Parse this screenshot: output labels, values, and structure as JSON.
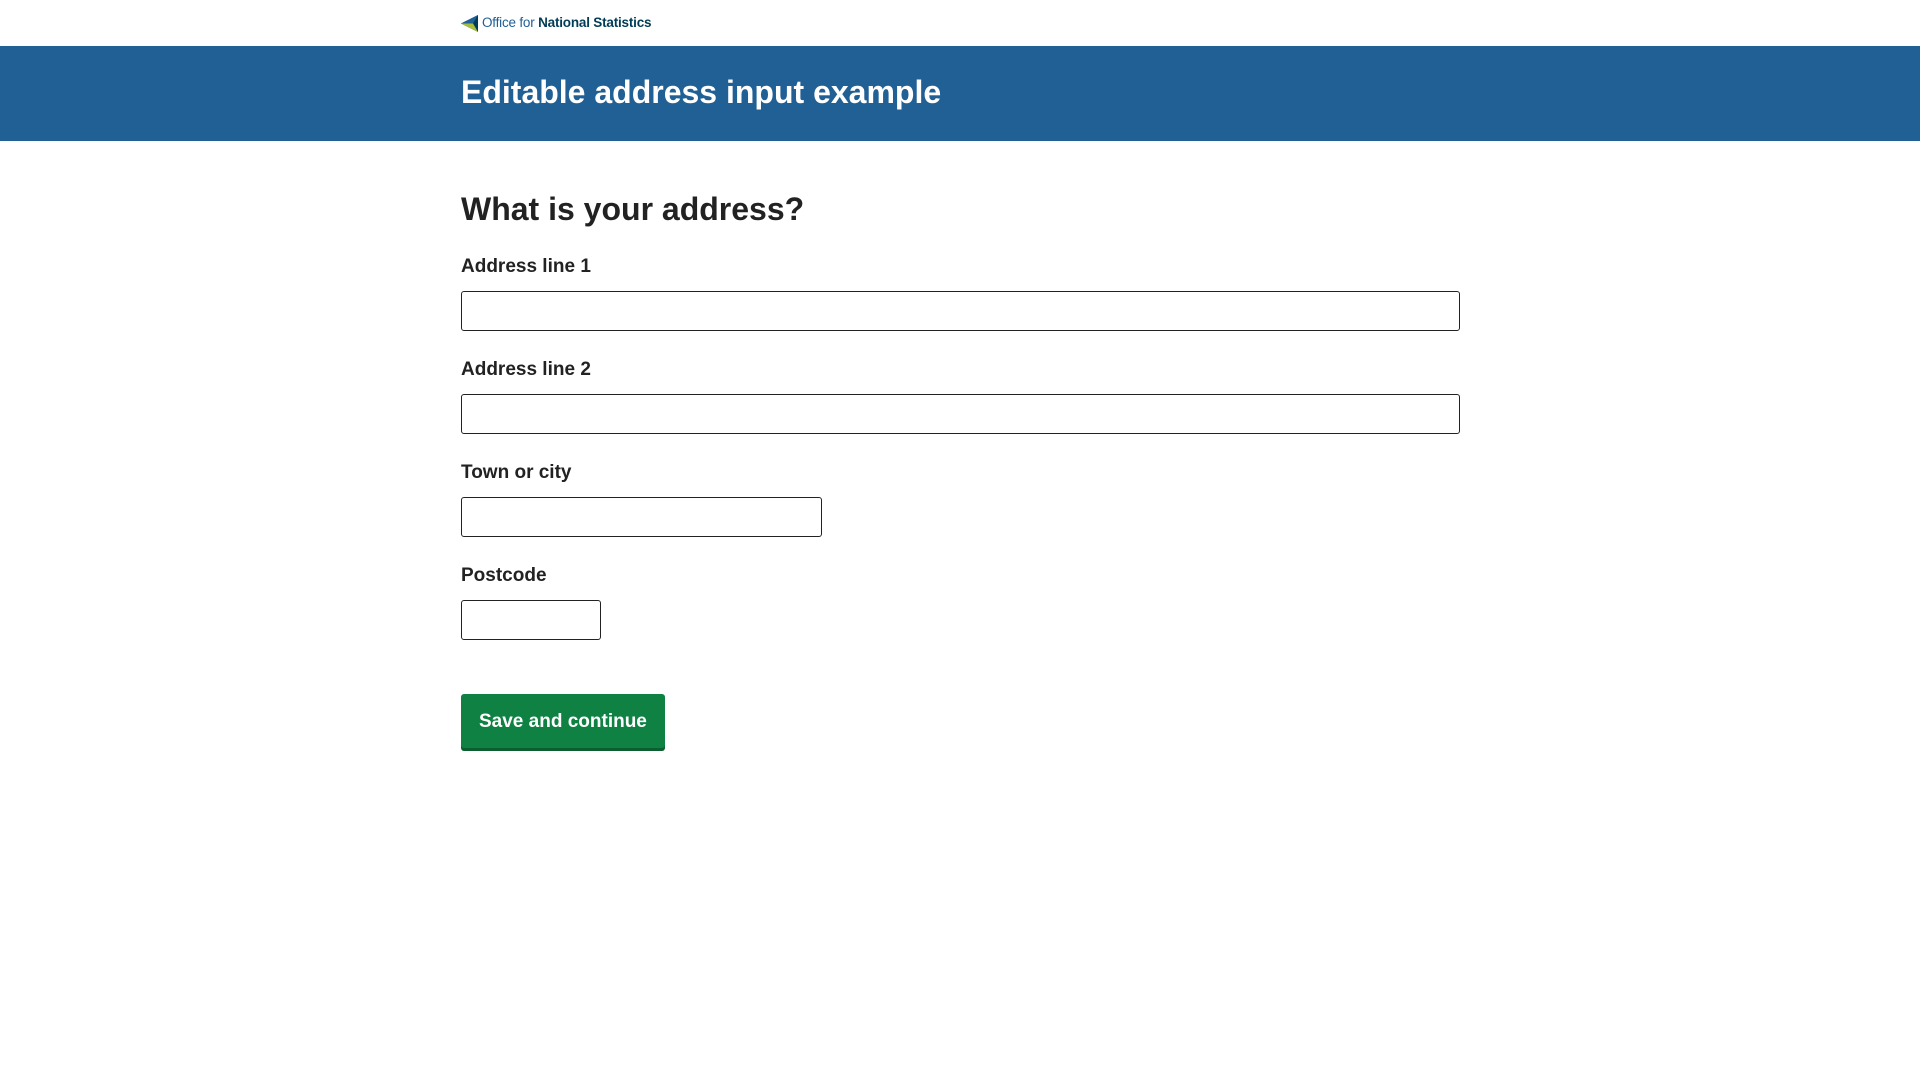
{
  "header": {
    "logo_prefix": "Office for",
    "logo_strong": "National Statistics",
    "logo_icon": "ons-logo-icon"
  },
  "banner": {
    "title": "Editable address input example"
  },
  "form": {
    "question": "What is your address?",
    "fields": [
      {
        "label": "Address line 1",
        "value": "",
        "placeholder": ""
      },
      {
        "label": "Address line 2",
        "value": "",
        "placeholder": ""
      },
      {
        "label": "Town or city",
        "value": "",
        "placeholder": ""
      },
      {
        "label": "Postcode",
        "value": "",
        "placeholder": ""
      }
    ],
    "submit_label": "Save and continue"
  },
  "colors": {
    "brand_blue": "#206095",
    "button_green": "#0f8243",
    "text": "#222222"
  }
}
